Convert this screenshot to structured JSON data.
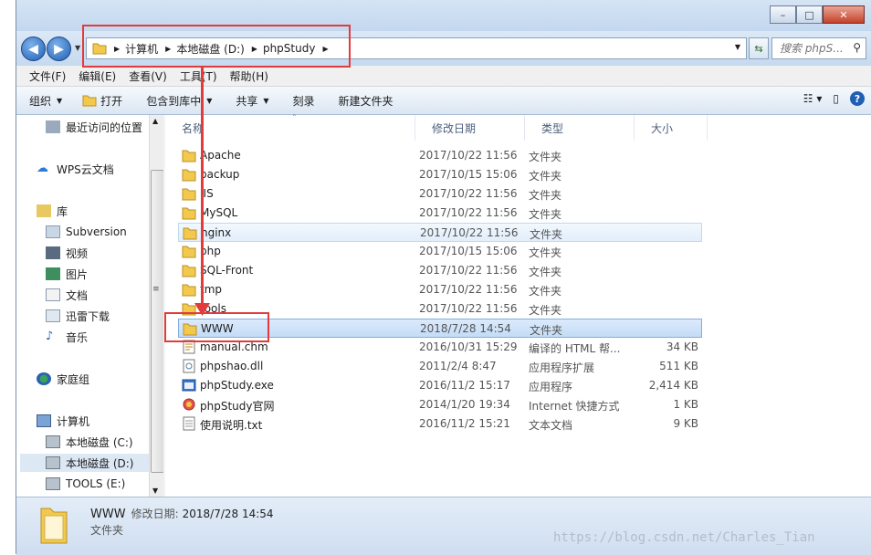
{
  "window": {
    "minimize_glyph": "–",
    "maximize_glyph": "□",
    "close_glyph": "✕"
  },
  "address": {
    "crumbs": [
      "计算机",
      "本地磁盘 (D:)",
      "phpStudy"
    ]
  },
  "search": {
    "placeholder": "搜索 phpS..."
  },
  "menu": [
    "文件(F)",
    "编辑(E)",
    "查看(V)",
    "工具(T)",
    "帮助(H)"
  ],
  "toolbar": {
    "organize": "组织",
    "open": "打开",
    "include_in_library": "包含到库中",
    "share": "共享",
    "burn": "刻录",
    "new_folder": "新建文件夹"
  },
  "nav": {
    "recent": "最近访问的位置",
    "wps": "WPS云文档",
    "libraries": "库",
    "subversion": "Subversion",
    "videos": "视频",
    "pictures": "图片",
    "documents": "文档",
    "thunder": "迅雷下载",
    "music": "音乐",
    "homegroup": "家庭组",
    "computer": "计算机",
    "drive_c": "本地磁盘 (C:)",
    "drive_d": "本地磁盘 (D:)",
    "drive_e": "TOOLS  (E:)"
  },
  "columns": {
    "name": "名称",
    "modified": "修改日期",
    "type": "类型",
    "size": "大小"
  },
  "files": [
    {
      "name": "Apache",
      "date": "2017/10/22 11:56",
      "type": "文件夹",
      "size": "",
      "icon": "folder"
    },
    {
      "name": "backup",
      "date": "2017/10/15 15:06",
      "type": "文件夹",
      "size": "",
      "icon": "folder"
    },
    {
      "name": "IIS",
      "date": "2017/10/22 11:56",
      "type": "文件夹",
      "size": "",
      "icon": "folder"
    },
    {
      "name": "MySQL",
      "date": "2017/10/22 11:56",
      "type": "文件夹",
      "size": "",
      "icon": "folder"
    },
    {
      "name": "nginx",
      "date": "2017/10/22 11:56",
      "type": "文件夹",
      "size": "",
      "icon": "folder"
    },
    {
      "name": "php",
      "date": "2017/10/15 15:06",
      "type": "文件夹",
      "size": "",
      "icon": "folder"
    },
    {
      "name": "SQL-Front",
      "date": "2017/10/22 11:56",
      "type": "文件夹",
      "size": "",
      "icon": "folder"
    },
    {
      "name": "tmp",
      "date": "2017/10/22 11:56",
      "type": "文件夹",
      "size": "",
      "icon": "folder"
    },
    {
      "name": "tools",
      "date": "2017/10/22 11:56",
      "type": "文件夹",
      "size": "",
      "icon": "folder"
    },
    {
      "name": "WWW",
      "date": "2018/7/28 14:54",
      "type": "文件夹",
      "size": "",
      "icon": "folder"
    },
    {
      "name": "manual.chm",
      "date": "2016/10/31 15:29",
      "type": "编译的 HTML 帮...",
      "size": "34 KB",
      "icon": "chm-file"
    },
    {
      "name": "phpshao.dll",
      "date": "2011/2/4 8:47",
      "type": "应用程序扩展",
      "size": "511 KB",
      "icon": "dll-file"
    },
    {
      "name": "phpStudy.exe",
      "date": "2016/11/2 15:17",
      "type": "应用程序",
      "size": "2,414 KB",
      "icon": "exe-file"
    },
    {
      "name": "phpStudy官网",
      "date": "2014/1/20 19:34",
      "type": "Internet 快捷方式",
      "size": "1 KB",
      "icon": "internet-shortcut"
    },
    {
      "name": "使用说明.txt",
      "date": "2016/11/2 15:21",
      "type": "文本文档",
      "size": "9 KB",
      "icon": "text-file"
    }
  ],
  "status": {
    "name": "WWW",
    "modified_label": "修改日期:",
    "modified_value": "2018/7/28 14:54",
    "type": "文件夹"
  },
  "watermark": "https://blog.csdn.net/Charles_Tian"
}
